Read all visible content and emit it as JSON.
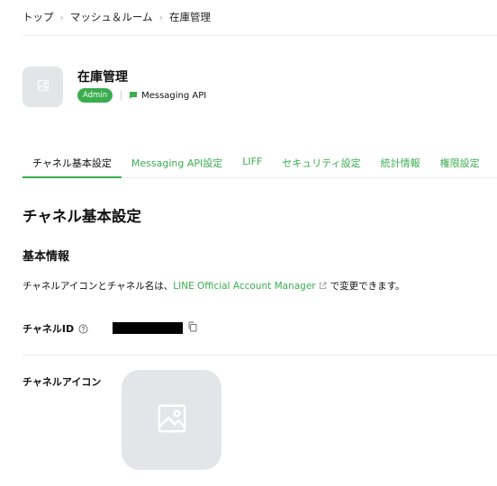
{
  "breadcrumb": {
    "items": [
      "トップ",
      "マッシュ＆ルーム",
      "在庫管理"
    ],
    "separator": "›"
  },
  "channel": {
    "name": "在庫管理",
    "role_badge": "Admin",
    "type_label": "Messaging API",
    "thumbnail_icon": "image-placeholder-icon"
  },
  "tabs": [
    {
      "label": "チャネル基本設定",
      "active": true
    },
    {
      "label": "Messaging API設定",
      "active": false
    },
    {
      "label": "LIFF",
      "active": false
    },
    {
      "label": "セキュリティ設定",
      "active": false
    },
    {
      "label": "統計情報",
      "active": false
    },
    {
      "label": "権限設定",
      "active": false
    }
  ],
  "page_title": "チャネル基本設定",
  "section_title": "基本情報",
  "description": {
    "prefix": "チャネルアイコンとチャネル名は、",
    "link": "LINE Official Account Manager",
    "suffix": "で変更できます。"
  },
  "fields": {
    "channel_id_label": "チャネルID",
    "channel_icon_label": "チャネルアイコン"
  },
  "colors": {
    "accent": "#3aad4f",
    "placeholder_bg": "#e4e5e9",
    "text": "#111111"
  }
}
